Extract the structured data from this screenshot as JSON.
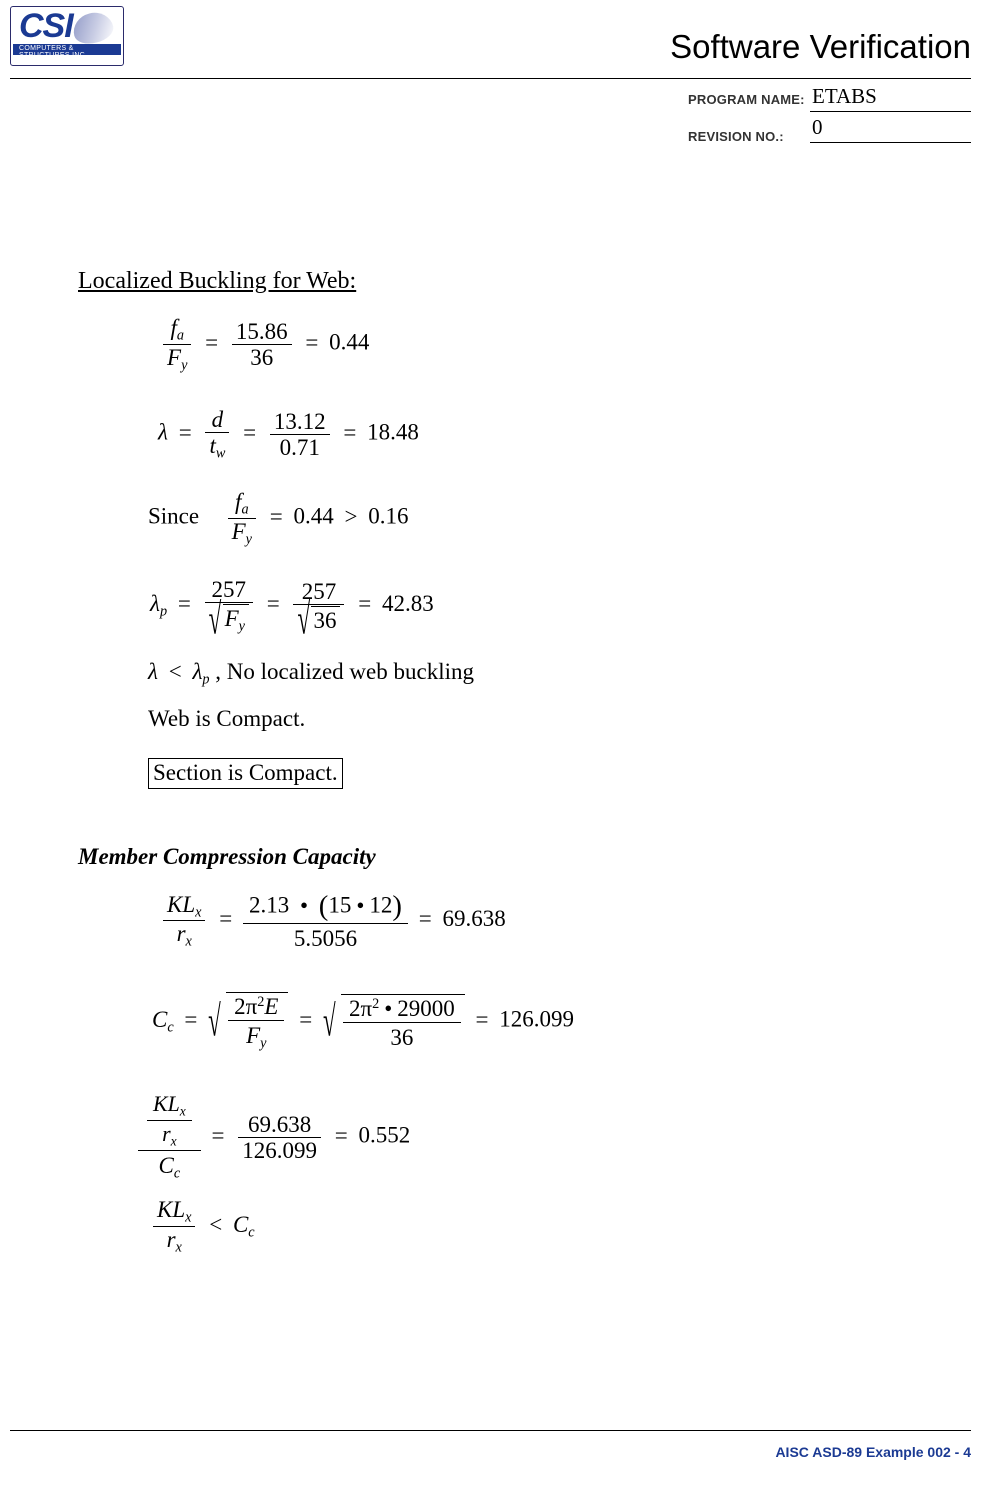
{
  "header": {
    "logo_text": "CSI",
    "logo_subtext": "COMPUTERS & STRUCTURES INC.",
    "title": "Software Verification",
    "program_name_label": "PROGRAM NAME:",
    "program_name_value": "ETABS",
    "revision_label": "REVISION NO.:",
    "revision_value": "0"
  },
  "body": {
    "section_web_heading": "Localized Buckling for Web:",
    "eq_fa_over_fy": {
      "lhs_num": "f",
      "lhs_num_sub": "a",
      "lhs_den": "F",
      "lhs_den_sub": "y",
      "mid_num": "15.86",
      "mid_den": "36",
      "result": "0.44"
    },
    "eq_lambda": {
      "symbol": "λ",
      "num": "d",
      "den": "t",
      "den_sub": "w",
      "mid_num": "13.12",
      "mid_den": "0.71",
      "result": "18.48"
    },
    "since_line": {
      "prefix": "Since",
      "num": "f",
      "num_sub": "a",
      "den": "F",
      "den_sub": "y",
      "value": "0.44",
      "comparator": ">",
      "limit": "0.16"
    },
    "eq_lambda_p": {
      "symbol": "λ",
      "symbol_sub": "p",
      "num1": "257",
      "den1": "F",
      "den1_sub": "y",
      "num2": "257",
      "den2": "36",
      "result": "42.83"
    },
    "lambda_compare_line": {
      "lhs": "λ",
      "comparator": "<",
      "rhs": "λ",
      "rhs_sub": "p",
      "text": ", No localized web buckling"
    },
    "web_compact": "Web is Compact.",
    "section_compact_boxed": "Section is Compact.",
    "section_compression_heading": "Member Compression Capacity",
    "eq_klx_rx": {
      "num": "KL",
      "num_sub": "x",
      "den": "r",
      "den_sub": "x",
      "factor": "2.13",
      "paren_a": "15",
      "paren_b": "12",
      "divisor": "5.5056",
      "result": "69.638"
    },
    "eq_cc": {
      "symbol": "C",
      "symbol_sub": "c",
      "num_coef": "2",
      "num_pi": "π",
      "num_pow": "2",
      "num_e": "E",
      "den_f": "F",
      "den_f_sub": "y",
      "num2_coef": "2",
      "num2_pi": "π",
      "num2_pow": "2",
      "num2_val": "29000",
      "den2_val": "36",
      "result": "126.099"
    },
    "eq_ratio": {
      "num_top": "KL",
      "num_top_sub": "x",
      "num_bot": "r",
      "num_bot_sub": "x",
      "den": "C",
      "den_sub": "c",
      "val_num": "69.638",
      "val_den": "126.099",
      "result": "0.552"
    },
    "eq_final": {
      "num": "KL",
      "num_sub": "x",
      "den": "r",
      "den_sub": "x",
      "comparator": "<",
      "rhs": "C",
      "rhs_sub": "c"
    }
  },
  "footer": {
    "text": "AISC ASD-89 Example 002 - 4"
  }
}
